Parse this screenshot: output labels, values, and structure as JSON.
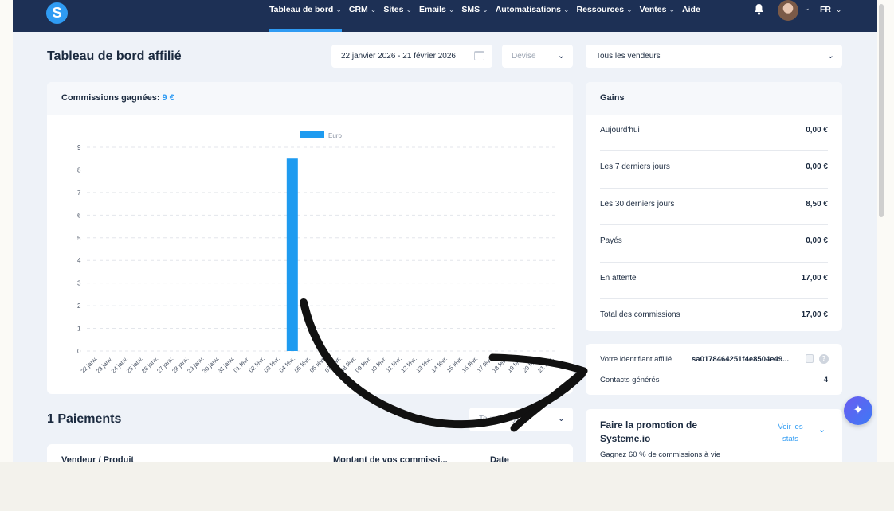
{
  "nav": {
    "logo": "S",
    "items": [
      {
        "label": "Tableau de bord",
        "active": true
      },
      {
        "label": "CRM"
      },
      {
        "label": "Sites"
      },
      {
        "label": "Emails"
      },
      {
        "label": "SMS"
      },
      {
        "label": "Automatisations"
      },
      {
        "label": "Ressources"
      },
      {
        "label": "Ventes"
      },
      {
        "label": "Aide"
      }
    ],
    "chevron": "⌄",
    "language": "FR"
  },
  "header": {
    "title": "Tableau de bord affilié",
    "date_range": "22 janvier 2026 - 21 février 2026",
    "currency_placeholder": "Devise",
    "vendor_select": "Tous les vendeurs"
  },
  "commissions": {
    "label": "Commissions gagnées:",
    "value": "9 €"
  },
  "chart_data": {
    "type": "bar",
    "legend": [
      "Euro"
    ],
    "legend_position": "top-center",
    "grid": true,
    "color": "#1e9bf0",
    "ylim": [
      0,
      9
    ],
    "yticks": [
      0,
      1,
      2,
      3,
      4,
      5,
      6,
      7,
      8,
      9
    ],
    "categories": [
      "22 janv.",
      "23 janv.",
      "24 janv.",
      "25 janv.",
      "26 janv.",
      "27 janv.",
      "28 janv.",
      "29 janv.",
      "30 janv.",
      "31 janv.",
      "01 févr.",
      "02 févr.",
      "03 févr.",
      "04 févr.",
      "05 févr.",
      "06 févr.",
      "07 févr.",
      "08 févr.",
      "09 févr.",
      "10 févr.",
      "11 févr.",
      "12 févr.",
      "13 févr.",
      "14 févr.",
      "15 févr.",
      "16 févr.",
      "17 févr.",
      "18 févr.",
      "19 févr.",
      "20 févr.",
      "21 févr."
    ],
    "series": [
      {
        "name": "Euro",
        "values": [
          0,
          0,
          0,
          0,
          0,
          0,
          0,
          0,
          0,
          0,
          0,
          0,
          0,
          8.5,
          0,
          0,
          0,
          0,
          0,
          0,
          0,
          0,
          0,
          0,
          0,
          0,
          0,
          0,
          0,
          0,
          0
        ]
      }
    ]
  },
  "gains": {
    "title": "Gains",
    "rows": [
      {
        "label": "Aujourd'hui",
        "value": "0,00 €"
      },
      {
        "label": "Les 7 derniers jours",
        "value": "0,00 €"
      },
      {
        "label": "Les 30 derniers jours",
        "value": "8,50 €"
      },
      {
        "label": "Payés",
        "value": "0,00 €"
      },
      {
        "label": "En attente",
        "value": "17,00 €"
      },
      {
        "label": "Total des commissions",
        "value": "17,00 €"
      }
    ]
  },
  "affiliate": {
    "id_label": "Votre identifiant affilié",
    "id_value": "sa0178464251f4e8504e49...",
    "contacts_label": "Contacts générés",
    "contacts_value": "4"
  },
  "promo": {
    "title": "Faire la promotion de Systeme.io",
    "link": "Voir les stats",
    "subtitle": "Gagnez 60 % de commissions à vie"
  },
  "payments": {
    "title": "1 Paiements",
    "filter": "Tous les types",
    "columns": [
      "Vendeur / Produit",
      "Montant de vos commissi...",
      "Date"
    ]
  },
  "ai_button": "✦"
}
